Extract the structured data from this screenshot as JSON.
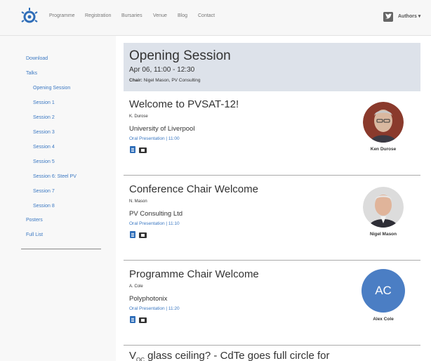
{
  "navbar": {
    "items": [
      "Programme",
      "Registration",
      "Bursaries",
      "Venue",
      "Blog",
      "Contact"
    ],
    "authors_label": "Authors",
    "caret": "▾"
  },
  "sidebar": {
    "items": [
      "Download",
      "Talks",
      "Opening Session",
      "Session 1",
      "Session 2",
      "Session 3",
      "Session 4",
      "Session 5",
      "Session 6: Steel PV",
      "Session 7",
      "Session 8",
      "Posters",
      "Full List"
    ]
  },
  "session": {
    "title": "Opening Session",
    "time": "Apr 06, 11:00 - 12:30",
    "chair_label": "Chair:",
    "chair_value": "Nigel Mason, PV Consulting"
  },
  "talks": [
    {
      "title": "Welcome to PVSAT-12!",
      "author": "K. Durose",
      "affiliation": "University of Liverpool",
      "meta": "Oral Presentation | 11:00",
      "speaker": "Ken Durose"
    },
    {
      "title": "Conference Chair Welcome",
      "author": "N. Mason",
      "affiliation": "PV Consulting Ltd",
      "meta": "Oral Presentation | 11:10",
      "speaker": "Nigel Mason"
    },
    {
      "title": "Programme Chair Welcome",
      "author": "A. Cole",
      "affiliation": "Polyphotonix",
      "meta": "Oral Presentation | 11:20",
      "speaker": "Alex Cole",
      "initials": "AC"
    },
    {
      "title_prefix": "V",
      "title_sub": "OC",
      "title_rest": " glass ceiling? - CdTe goes full circle for"
    }
  ],
  "colors": {
    "accent": "#3b78c2",
    "header_bg": "#dde2ea",
    "initials_bg": "#4b7ec4"
  }
}
